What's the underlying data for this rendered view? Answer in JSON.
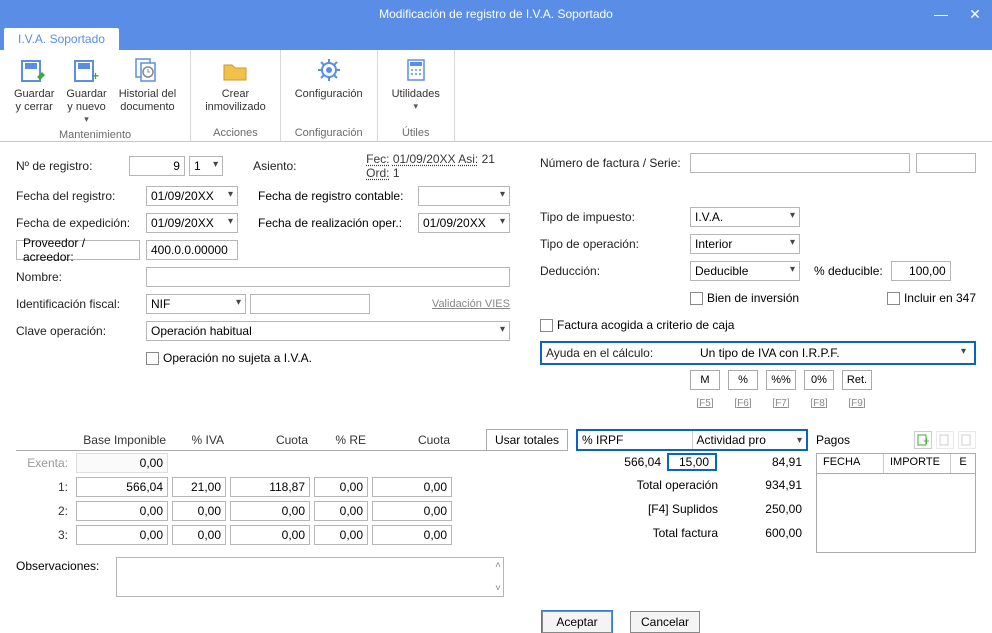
{
  "title": "Modificación de registro de I.V.A. Soportado",
  "tab": "I.V.A. Soportado",
  "ribbon": {
    "guardar_cerrar": "Guardar\ny cerrar",
    "guardar_nuevo": "Guardar\ny nuevo",
    "historial": "Historial del\ndocumento",
    "grp_mant": "Mantenimiento",
    "crear_inm": "Crear\ninmovilizado",
    "grp_acc": "Acciones",
    "config": "Configuración",
    "grp_conf": "Configuración",
    "utils": "Utilidades",
    "grp_util": "Útiles"
  },
  "left": {
    "nreg_lbl": "Nº de registro:",
    "nreg_a": "9",
    "nreg_b": "1",
    "asiento_lbl": "Asiento:",
    "asiento_fec_lbl": "Fec:",
    "asiento_fec": "01/09/20XX",
    "asiento_asi_lbl": "Asi:",
    "asiento_asi": "21",
    "asiento_ord_lbl": "Ord:",
    "asiento_ord": "1",
    "freg_lbl": "Fecha del registro:",
    "freg": "01/09/20XX",
    "fregc_lbl": "Fecha de registro contable:",
    "fexp_lbl": "Fecha de expedición:",
    "fexp": "01/09/20XX",
    "freal_lbl": "Fecha de realización oper.:",
    "freal": "01/09/20XX",
    "prov_lbl": "Proveedor / acreedor:",
    "prov": "400.0.0.00000",
    "nombre_lbl": "Nombre:",
    "ident_lbl": "Identificación fiscal:",
    "ident_sel": "NIF",
    "valid": "Validación VIES",
    "clave_lbl": "Clave operación:",
    "clave": "Operación habitual",
    "op_no_sujeta": "Operación no sujeta a I.V.A."
  },
  "right": {
    "nfact_lbl": "Número de factura / Serie:",
    "timp_lbl": "Tipo de impuesto:",
    "timp": "I.V.A.",
    "top_lbl": "Tipo de operación:",
    "top": "Interior",
    "ded_lbl": "Deducción:",
    "ded": "Deducible",
    "pded_lbl": "% deducible:",
    "pded": "100,00",
    "bien_inv": "Bien de inversión",
    "inc347": "Incluir en 347",
    "fact_caja": "Factura acogida a criterio de caja",
    "ayuda_lbl": "Ayuda en el cálculo:",
    "ayuda": "Un tipo de IVA con I.R.P.F.",
    "calc": {
      "m": "M",
      "p": "%",
      "pp": "%%",
      "z": "0%",
      "r": "Ret."
    },
    "hints": {
      "f5": "[F5]",
      "f6": "[F6]",
      "f7": "[F7]",
      "f8": "[F8]",
      "f9": "[F9]"
    }
  },
  "grid": {
    "h_base": "Base Imponible",
    "h_piva": "% IVA",
    "h_cuota": "Cuota",
    "h_pre": "% RE",
    "h_cuota2": "Cuota",
    "exenta_lbl": "Exenta:",
    "exenta": "0,00",
    "r1_lbl": "1:",
    "r1_base": "566,04",
    "r1_piva": "21,00",
    "r1_cuota": "118,87",
    "r1_pre": "0,00",
    "r1_cuota2": "0,00",
    "r2_lbl": "2:",
    "r2_base": "0,00",
    "r2_piva": "0,00",
    "r2_cuota": "0,00",
    "r2_pre": "0,00",
    "r2_cuota2": "0,00",
    "r3_lbl": "3:",
    "r3_base": "0,00",
    "r3_piva": "0,00",
    "r3_cuota": "0,00",
    "r3_pre": "0,00",
    "r3_cuota2": "0,00",
    "usar": "Usar totales",
    "h_irpf": "% IRPF",
    "h_act": "Actividad pro",
    "irpf_base": "566,04",
    "irpf_p": "15,00",
    "irpf_v": "84,91",
    "tot_op_lbl": "Total operación",
    "tot_op": "934,91",
    "supl_lbl": "[F4] Suplidos",
    "supl": "250,00",
    "tot_fac_lbl": "Total factura",
    "tot_fac": "600,00",
    "pagos": "Pagos",
    "ph_fecha": "FECHA",
    "ph_imp": "IMPORTE",
    "ph_e": "E"
  },
  "obs_lbl": "Observaciones:",
  "aceptar": "Aceptar",
  "cancelar": "Cancelar"
}
